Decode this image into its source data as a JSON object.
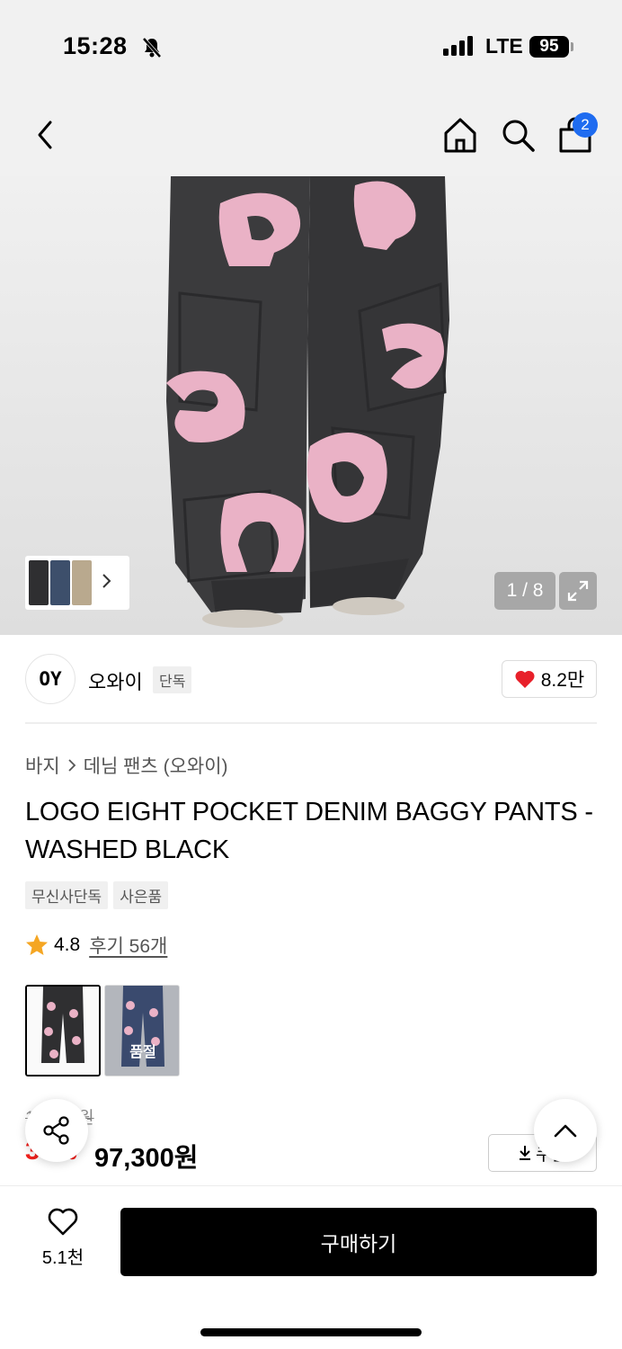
{
  "status": {
    "time": "15:28",
    "network": "LTE",
    "battery": "95"
  },
  "header": {
    "cart_count": "2"
  },
  "gallery": {
    "counter": "1 / 8"
  },
  "brand": {
    "logo_text": "OY",
    "name": "오와이",
    "tag": "단독",
    "likes": "8.2만"
  },
  "breadcrumb": {
    "category": "바지",
    "subcategory": "데님 팬츠 (오와이)"
  },
  "product": {
    "title": "LOGO EIGHT POCKET DENIM BAGGY PANTS - WASHED BLACK",
    "tags": [
      "무신사단독",
      "사은품"
    ],
    "rating": "4.8",
    "reviews": "후기 56개",
    "color_options": [
      {
        "name": "black",
        "soldout_label": ""
      },
      {
        "name": "blue",
        "soldout_label": "품절"
      }
    ]
  },
  "pricing": {
    "original": "1**,*00원",
    "discount": "30%",
    "price": "97,300원",
    "coupon_label": "쿠폰"
  },
  "bottom": {
    "wish_count": "5.1천",
    "buy_label": "구매하기"
  },
  "colors": {
    "accent_blue": "#1f6cf0",
    "discount_red": "#f0201c",
    "heart_red": "#e8202a"
  }
}
